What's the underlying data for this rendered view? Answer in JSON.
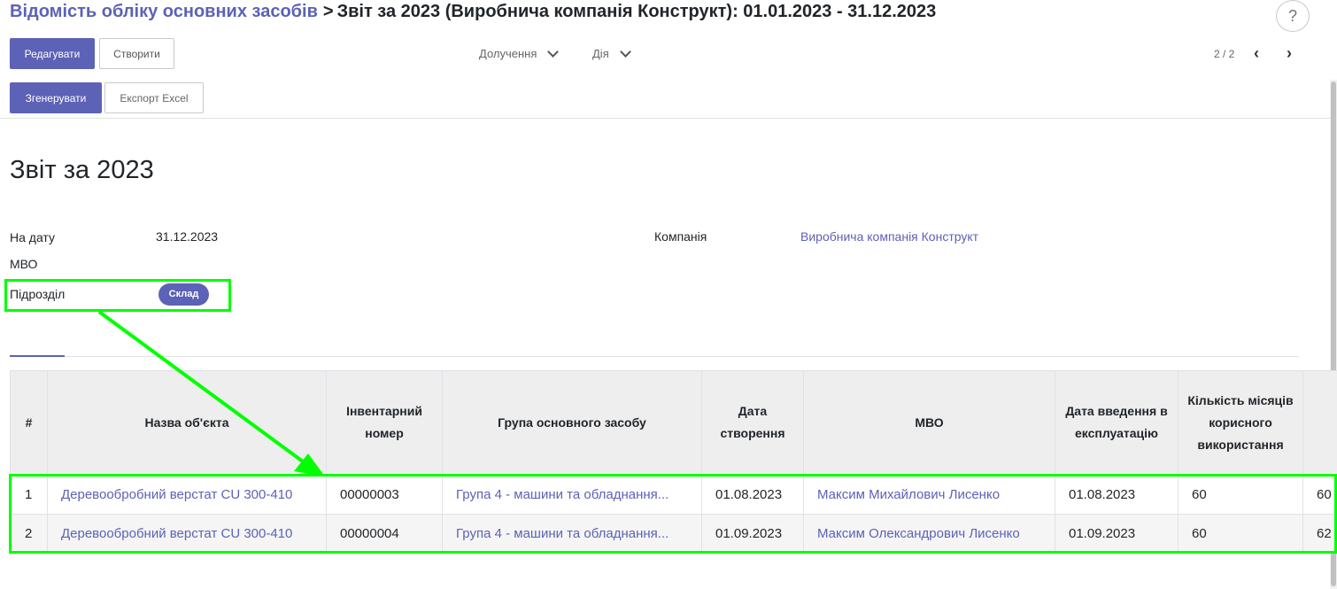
{
  "breadcrumb": {
    "parent": "Відомість обліку основних засобів",
    "separator": ">",
    "current": "Звіт за 2023 (Виробнича компанія Конструкт): 01.01.2023 - 31.12.2023"
  },
  "help_label": "?",
  "toolbar": {
    "edit_label": "Редагувати",
    "create_label": "Створити",
    "attachments_label": "Долучення",
    "action_label": "Дія",
    "pager": "2 / 2",
    "prev_label": "‹",
    "next_label": "›"
  },
  "actions": {
    "generate_label": "Згенерувати",
    "export_label": "Експорт Excel"
  },
  "form": {
    "title": "Звіт за 2023",
    "date_label": "На дату",
    "date_value": "31.12.2023",
    "mvo_label": "МВО",
    "department_label": "Підрозділ",
    "department_tag": "Склад",
    "company_label": "Компанія",
    "company_value": "Виробнича компанія Конструкт"
  },
  "table": {
    "columns": [
      "#",
      "Назва об'єкта",
      "Інвентарний номер",
      "Група основного засобу",
      "Дата створення",
      "МВО",
      "Дата введення в експлуатацію",
      "Кількість місяців корисного використання",
      ""
    ],
    "rows": [
      [
        "1",
        "Деревообробний верстат CU 300-410",
        "00000003",
        "Група 4 - машини та обладнання...",
        "01.08.2023",
        "Максим Михайлович Лисенко",
        "01.08.2023",
        "60",
        "60"
      ],
      [
        "2",
        "Деревообробний верстат CU 300-410",
        "00000004",
        "Група 4 - машини та обладнання...",
        "01.09.2023",
        "Максим Олександрович Лисенко",
        "01.09.2023",
        "60",
        "62"
      ]
    ]
  },
  "colors": {
    "accent": "#5c62b6",
    "annotation": "#00ff00"
  }
}
